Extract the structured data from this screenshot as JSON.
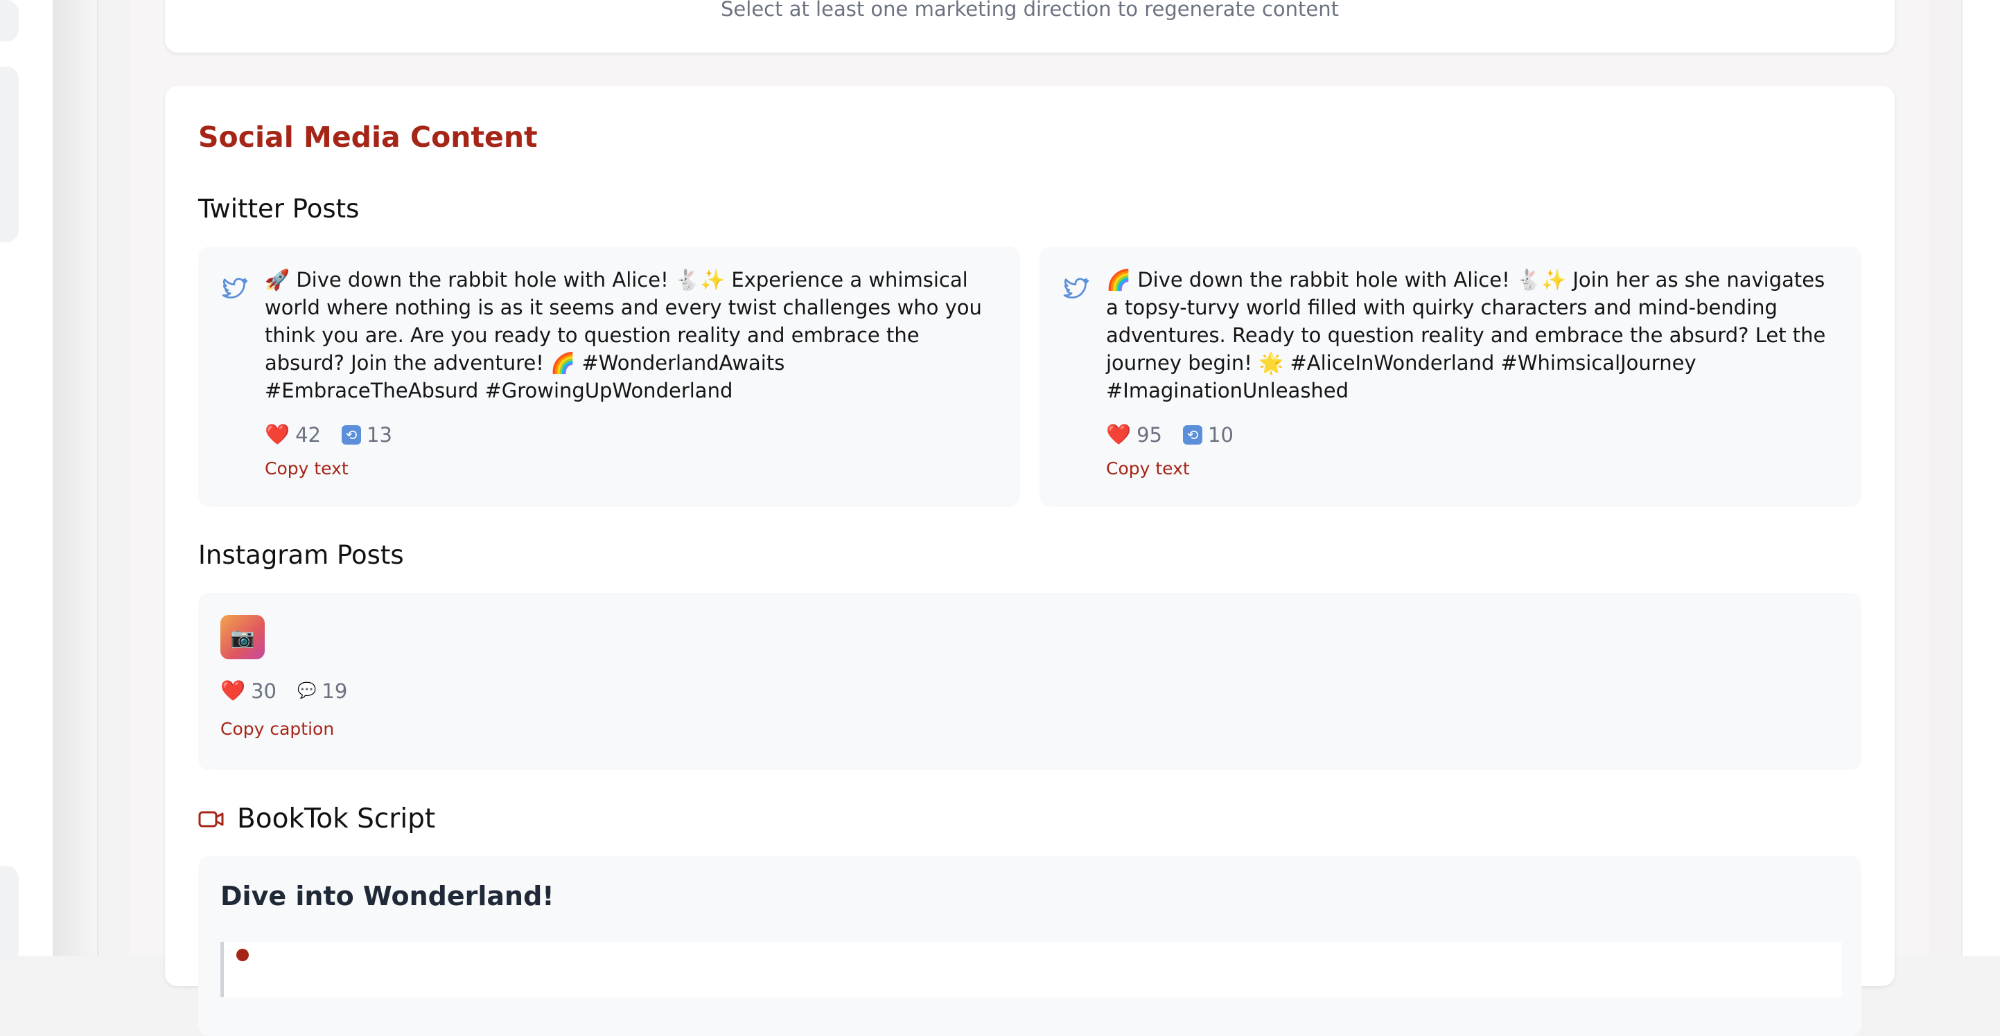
{
  "directions_card": {
    "hint": "Select at least one marketing direction to regenerate content"
  },
  "social": {
    "title": "Social Media Content",
    "twitter_heading": "Twitter Posts",
    "tweets": [
      {
        "text": "🚀 Dive down the rabbit hole with Alice! 🐇✨ Experience a whimsical world where nothing is as it seems and every twist challenges who you think you are. Are you ready to question reality and embrace the absurd? Join the adventure! 🌈 #WonderlandAwaits #EmbraceTheAbsurd #GrowingUpWonderland",
        "likes": "42",
        "retweets": "13",
        "copy_label": "Copy text"
      },
      {
        "text": "🌈 Dive down the rabbit hole with Alice! 🐇✨ Join her as she navigates a topsy-turvy world filled with quirky characters and mind-bending adventures. Ready to question reality and embrace the absurd? Let the journey begin! 🌟 #AliceInWonderland #WhimsicalJourney #ImaginationUnleashed",
        "likes": "95",
        "retweets": "10",
        "copy_label": "Copy text"
      }
    ],
    "instagram_heading": "Instagram Posts",
    "instagram": {
      "image_emoji": "📷",
      "likes": "30",
      "comments": "19",
      "copy_label": "Copy caption"
    },
    "booktok_heading": "BookTok Script",
    "booktok": {
      "title": "Dive into Wonderland!"
    }
  },
  "icons": {
    "twitter": "twitter-bird-icon",
    "heart": "❤️",
    "retweet": "🔁",
    "comment": "💬",
    "video": "video-camera-icon"
  },
  "colors": {
    "accent": "#a52517",
    "twitter_blue": "#5b8fd9",
    "muted_text": "#6b7280",
    "card_bg": "#ffffff",
    "post_bg": "#f8f9fb"
  }
}
